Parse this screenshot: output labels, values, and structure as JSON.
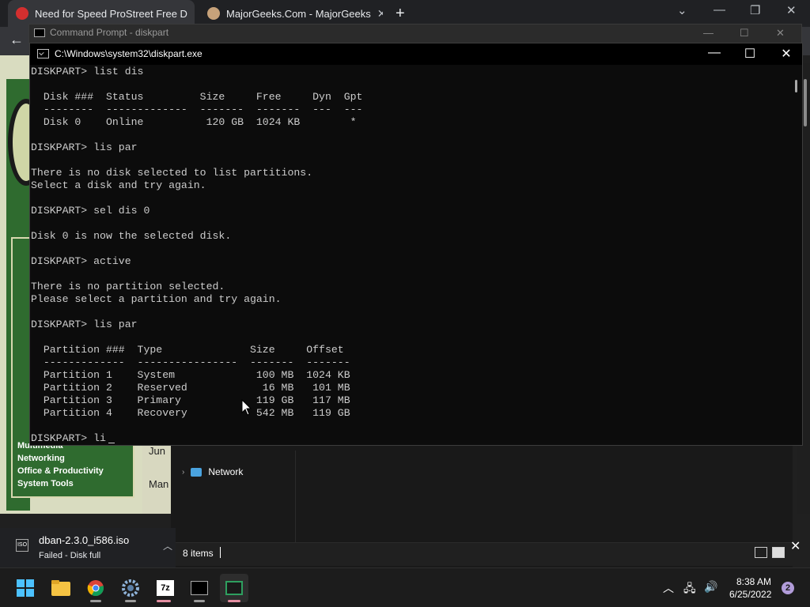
{
  "browser": {
    "tabs": [
      {
        "title": "Need for Speed ProStreet Free D"
      },
      {
        "title": "MajorGeeks.Com - MajorGeeks"
      }
    ],
    "new_tab_glyph": "+"
  },
  "webpage": {
    "categories": [
      "Multimedia",
      "Networking",
      "Office & Productivity",
      "System Tools"
    ],
    "center_snippets": [
      "Jun",
      "Man"
    ]
  },
  "cmd_back": {
    "title": "Command Prompt - diskpart"
  },
  "diskpart": {
    "title": "C:\\Windows\\system32\\diskpart.exe",
    "lines": [
      "DISKPART> list dis",
      "",
      "  Disk ###  Status         Size     Free     Dyn  Gpt",
      "  --------  -------------  -------  -------  ---  ---",
      "  Disk 0    Online          120 GB  1024 KB        *",
      "",
      "DISKPART> lis par",
      "",
      "There is no disk selected to list partitions.",
      "Select a disk and try again.",
      "",
      "DISKPART> sel dis 0",
      "",
      "Disk 0 is now the selected disk.",
      "",
      "DISKPART> active",
      "",
      "There is no partition selected.",
      "Please select a partition and try again.",
      "",
      "DISKPART> lis par",
      "",
      "  Partition ###  Type              Size     Offset",
      "  -------------  ----------------  -------  -------",
      "  Partition 1    System             100 MB  1024 KB",
      "  Partition 2    Reserved            16 MB   101 MB",
      "  Partition 3    Primary            119 GB   117 MB",
      "  Partition 4    Recovery           542 MB   119 GB",
      "",
      "DISKPART> li"
    ]
  },
  "explorer": {
    "nav_item": "Network",
    "status_items": "8 items"
  },
  "download": {
    "filename": "dban-2.3.0_i586.iso",
    "icon_text": "ISO",
    "status": "Failed - Disk full"
  },
  "taskbar": {
    "apps": [
      "start-icon",
      "file-explorer-icon",
      "chrome-icon",
      "settings-icon",
      "7zip-icon",
      "command-prompt-icon",
      "diskpart-icon"
    ],
    "time": "8:38 AM",
    "date": "6/25/2022",
    "notification_count": "2"
  },
  "colors": {
    "console_bg": "#0c0c0c",
    "console_fg": "#cccccc",
    "taskbar_bg": "#1c1c1c",
    "page_green": "#2f6b2f"
  }
}
